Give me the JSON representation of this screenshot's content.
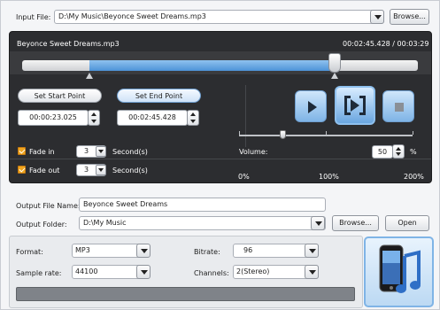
{
  "input": {
    "label": "Input File:",
    "value": "D:\\My Music\\Beyonce Sweet Dreams.mp3",
    "browse": "Browse..."
  },
  "player": {
    "filename": "Beyonce Sweet Dreams.mp3",
    "time": "00:02:45.428 / 00:03:29",
    "selection_start_fraction": 0.17,
    "selection_end_fraction": 0.79,
    "set_start": "Set Start Point",
    "set_end": "Set End Point",
    "start_time": "00:00:23.025",
    "end_time": "00:02:45.428"
  },
  "fade": {
    "in_label": "Fade in",
    "in_value": "3",
    "out_label": "Fade out",
    "out_value": "3",
    "unit": "Second(s)"
  },
  "volume": {
    "label": "Volume:",
    "value": "50",
    "unit": "%",
    "slider_fraction": 0.25,
    "ticks": [
      "0%",
      "100%",
      "200%"
    ]
  },
  "output": {
    "name_label": "Output File Name:",
    "name_value": "Beyonce Sweet Dreams",
    "folder_label": "Output Folder:",
    "folder_value": "D:\\My Music",
    "browse": "Browse...",
    "open": "Open"
  },
  "settings": {
    "format_label": "Format:",
    "format_value": "MP3",
    "bitrate_label": "Bitrate:",
    "bitrate_value": "96",
    "samplerate_label": "Sample rate:",
    "samplerate_value": "44100",
    "channels_label": "Channels:",
    "channels_value": "2(Stereo)"
  },
  "icons": {
    "play": "play-icon",
    "play_selection": "play-selection-icon",
    "stop": "stop-icon",
    "device": "phone-music-device-icon"
  },
  "colors": {
    "accent_blue": "#4d93d8",
    "panel_dark": "#2c2d30",
    "check_orange": "#f0a51f"
  }
}
